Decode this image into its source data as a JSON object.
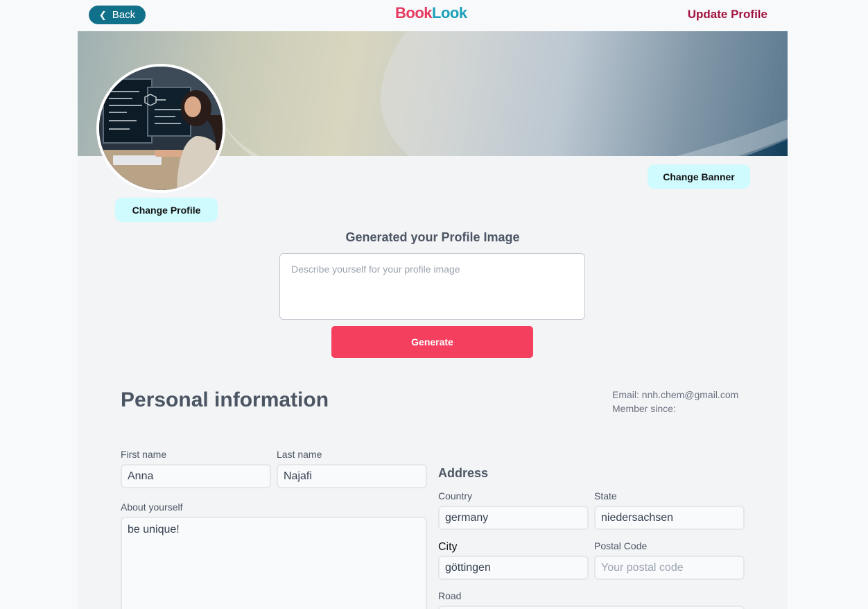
{
  "header": {
    "back_label": "Back",
    "logo_part1": "Book",
    "logo_part2": "Look",
    "page_title": "Update Profile"
  },
  "profile": {
    "change_banner_label": "Change Banner",
    "change_profile_label": "Change Profile"
  },
  "generator": {
    "title": "Generated your Profile Image",
    "placeholder": "Describe yourself for your profile image",
    "generate_label": "Generate"
  },
  "personal": {
    "title": "Personal information",
    "email_line": "Email: nnh.chem@gmail.com",
    "member_line": "Member since:",
    "first_name_label": "First name",
    "first_name_value": "Anna",
    "last_name_label": "Last name",
    "last_name_value": "Najafi",
    "about_label": "About yourself",
    "about_value": "be unique!"
  },
  "address": {
    "title": "Address",
    "country_label": "Country",
    "country_value": "germany",
    "state_label": "State",
    "state_value": "niedersachsen",
    "city_label": "City",
    "city_value": "göttingen",
    "postal_label": "Postal Code",
    "postal_placeholder": "Your postal code",
    "road_label": "Road"
  },
  "colors": {
    "back_button": "#12718a",
    "logo_red": "#e6395f",
    "logo_teal": "#1aa0b8",
    "title_red": "#a0123e",
    "generate_button": "#f43f5e",
    "pill_button": "#cffafe"
  }
}
